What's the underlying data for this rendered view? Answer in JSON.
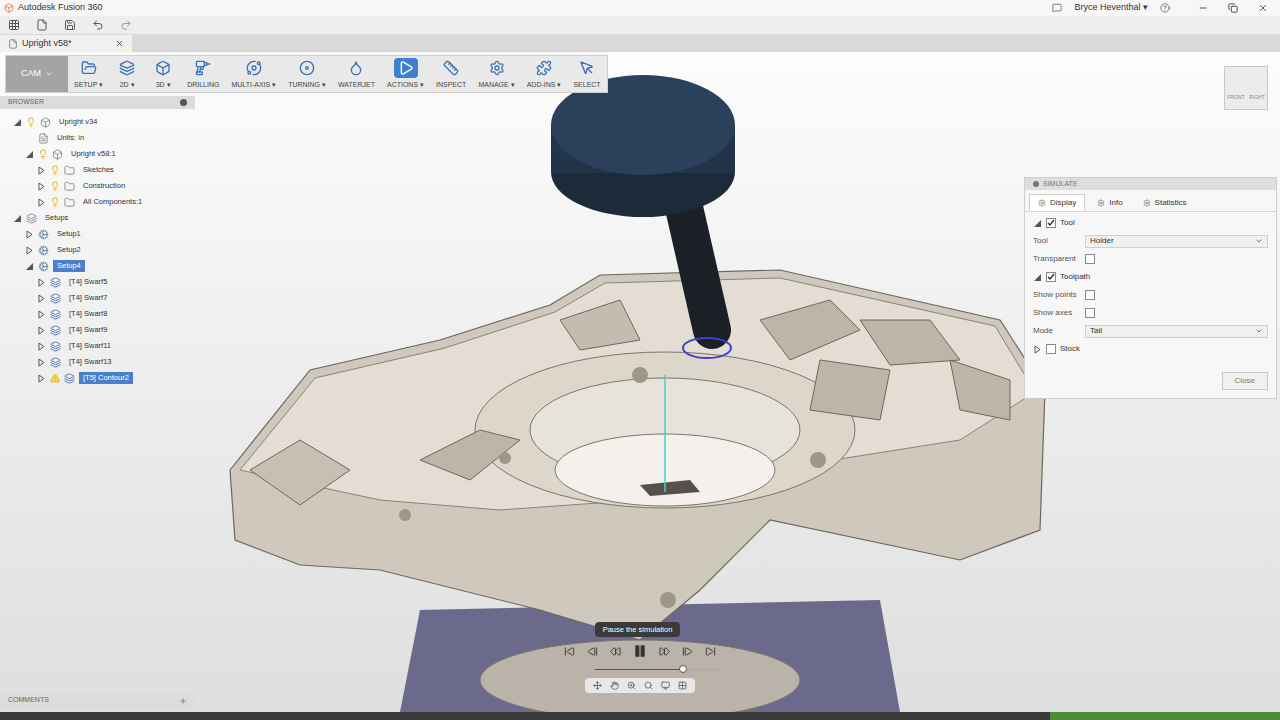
{
  "window": {
    "title": "Autodesk Fusion 360",
    "user": "Bryce Heventhal ▾"
  },
  "document_tab": {
    "label": "Upright v58*"
  },
  "toolbar": {
    "mode": "CAM",
    "items": [
      {
        "label": "SETUP ▾",
        "selected": false
      },
      {
        "label": "2D ▾",
        "selected": false
      },
      {
        "label": "3D ▾",
        "selected": false
      },
      {
        "label": "DRILLING",
        "selected": false
      },
      {
        "label": "MULTI-AXIS ▾",
        "selected": false
      },
      {
        "label": "TURNING ▾",
        "selected": false
      },
      {
        "label": "WATERJET",
        "selected": false
      },
      {
        "label": "ACTIONS ▾",
        "selected": true
      },
      {
        "label": "INSPECT",
        "selected": false
      },
      {
        "label": "MANAGE ▾",
        "selected": false
      },
      {
        "label": "ADD-INS ▾",
        "selected": false
      },
      {
        "label": "SELECT",
        "selected": false
      }
    ]
  },
  "browser": {
    "title": "BROWSER",
    "items": [
      {
        "label": "Upright v34",
        "level": 0,
        "kind": "component",
        "expandable": true,
        "expanded": true,
        "selected": false,
        "warning": false
      },
      {
        "label": "Units: in",
        "level": 1,
        "kind": "units",
        "expandable": false,
        "expanded": false,
        "selected": false,
        "warning": false
      },
      {
        "label": "Upright v58:1",
        "level": 1,
        "kind": "component",
        "expandable": true,
        "expanded": true,
        "selected": false,
        "warning": false
      },
      {
        "label": "Sketches",
        "level": 2,
        "kind": "folder",
        "expandable": true,
        "expanded": false,
        "selected": false,
        "warning": false
      },
      {
        "label": "Construction",
        "level": 2,
        "kind": "folder",
        "expandable": true,
        "expanded": false,
        "selected": false,
        "warning": false
      },
      {
        "label": "All Components:1",
        "level": 2,
        "kind": "folder",
        "expandable": true,
        "expanded": false,
        "selected": false,
        "warning": false
      },
      {
        "label": "Setups",
        "level": 0,
        "kind": "setups",
        "expandable": true,
        "expanded": true,
        "selected": false,
        "warning": false
      },
      {
        "label": "Setup1",
        "level": 1,
        "kind": "setup",
        "expandable": true,
        "expanded": false,
        "selected": false,
        "warning": false
      },
      {
        "label": "Setup2",
        "level": 1,
        "kind": "setup",
        "expandable": true,
        "expanded": false,
        "selected": false,
        "warning": false
      },
      {
        "label": "Setup4",
        "level": 1,
        "kind": "setup",
        "expandable": true,
        "expanded": true,
        "selected": true,
        "warning": false
      },
      {
        "label": "[T4] Swarf5",
        "level": 2,
        "kind": "operation",
        "expandable": true,
        "expanded": false,
        "selected": false,
        "warning": false
      },
      {
        "label": "[T4] Swarf7",
        "level": 2,
        "kind": "operation",
        "expandable": true,
        "expanded": false,
        "selected": false,
        "warning": false
      },
      {
        "label": "[T4] Swarf8",
        "level": 2,
        "kind": "operation",
        "expandable": true,
        "expanded": false,
        "selected": false,
        "warning": false
      },
      {
        "label": "[T4] Swarf9",
        "level": 2,
        "kind": "operation",
        "expandable": true,
        "expanded": false,
        "selected": false,
        "warning": false
      },
      {
        "label": "[T4] Swarf11",
        "level": 2,
        "kind": "operation",
        "expandable": true,
        "expanded": false,
        "selected": false,
        "warning": false
      },
      {
        "label": "[T4] Swarf13",
        "level": 2,
        "kind": "operation",
        "expandable": true,
        "expanded": false,
        "selected": false,
        "warning": false
      },
      {
        "label": "[T5] Contour2",
        "level": 2,
        "kind": "operation",
        "expandable": true,
        "expanded": false,
        "selected": true,
        "warning": true
      }
    ]
  },
  "comments": {
    "title": "COMMENTS"
  },
  "view_cube": {
    "front": "FRONT",
    "right": "RIGHT"
  },
  "simulate": {
    "title": "SIMULATE",
    "tabs": [
      {
        "label": "Display",
        "selected": true
      },
      {
        "label": "Info",
        "selected": false
      },
      {
        "label": "Statistics",
        "selected": false
      }
    ],
    "sections": [
      {
        "label": "Tool",
        "checked": true,
        "expanded": true,
        "rows": [
          {
            "kind": "select",
            "label": "Tool",
            "value": "Holder"
          },
          {
            "kind": "checkbox",
            "label": "Transparent",
            "checked": false
          }
        ]
      },
      {
        "label": "Toolpath",
        "checked": true,
        "expanded": true,
        "rows": [
          {
            "kind": "checkbox",
            "label": "Show points",
            "checked": false
          },
          {
            "kind": "checkbox",
            "label": "Show axes",
            "checked": false
          },
          {
            "kind": "select",
            "label": "Mode",
            "value": "Tail"
          }
        ]
      },
      {
        "label": "Stock",
        "checked": false,
        "expanded": false,
        "rows": []
      }
    ],
    "close": "Close"
  },
  "playback": {
    "tooltip": "Pause the simulation",
    "playing": true,
    "level": 0.68
  }
}
